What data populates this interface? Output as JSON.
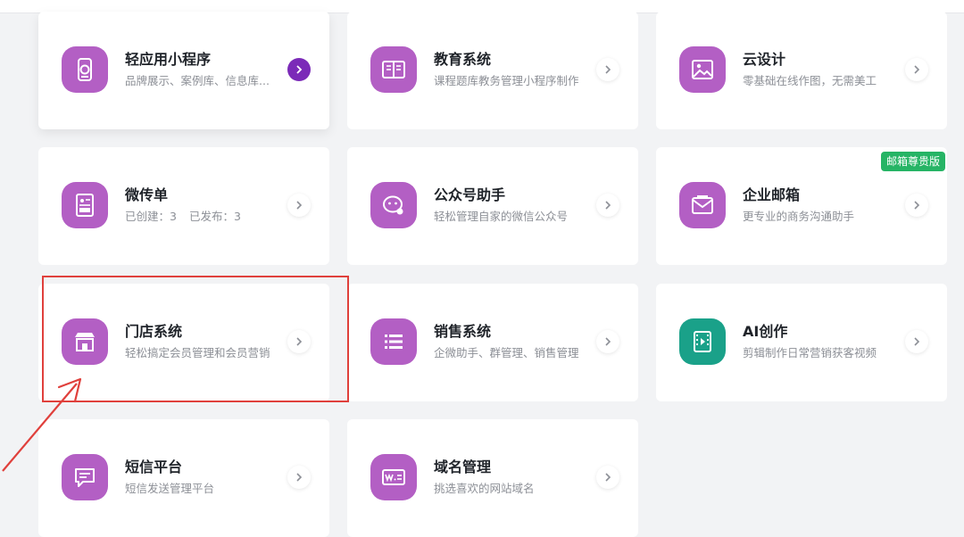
{
  "cards": [
    {
      "key": "mini-program",
      "title": "轻应用小程序",
      "subtitle": "品牌展示、案例库、信息库...",
      "icon": "mini-program-icon",
      "icon_color": "#b35fc4"
    },
    {
      "key": "education",
      "title": "教育系统",
      "subtitle": "课程题库教务管理小程序制作",
      "icon": "book-icon",
      "icon_color": "#b35fc4"
    },
    {
      "key": "cloud-design",
      "title": "云设计",
      "subtitle": "零基础在线作图，无需美工",
      "icon": "image-icon",
      "icon_color": "#b35fc4"
    },
    {
      "key": "flyer",
      "title": "微传单",
      "subtitle_created_label": "已创建：",
      "subtitle_created_value": "3",
      "subtitle_published_label": "已发布：",
      "subtitle_published_value": "3",
      "icon": "flyer-icon",
      "icon_color": "#b35fc4"
    },
    {
      "key": "official-account",
      "title": "公众号助手",
      "subtitle": "轻松管理自家的微信公众号",
      "icon": "wechat-icon",
      "icon_color": "#b35fc4"
    },
    {
      "key": "enterprise-mail",
      "title": "企业邮箱",
      "subtitle": "更专业的商务沟通助手",
      "icon": "mail-icon",
      "icon_color": "#b35fc4",
      "badge": "邮箱尊贵版",
      "badge_color": "#26b465"
    },
    {
      "key": "store-system",
      "title": "门店系统",
      "subtitle": "轻松搞定会员管理和会员营销",
      "icon": "store-icon",
      "icon_color": "#b35fc4"
    },
    {
      "key": "sales-system",
      "title": "销售系统",
      "subtitle": "企微助手、群管理、销售管理",
      "icon": "list-icon",
      "icon_color": "#b35fc4"
    },
    {
      "key": "ai-creation",
      "title": "AI创作",
      "subtitle": "剪辑制作日常营销获客视频",
      "icon": "video-icon",
      "icon_color": "#1aa189"
    },
    {
      "key": "sms-platform",
      "title": "短信平台",
      "subtitle": "短信发送管理平台",
      "icon": "message-icon",
      "icon_color": "#b35fc4"
    },
    {
      "key": "domain-management",
      "title": "域名管理",
      "subtitle": "挑选喜欢的网站域名",
      "icon": "domain-icon",
      "icon_color": "#b35fc4"
    }
  ],
  "annotation": {
    "highlight_color": "#e0403c"
  },
  "accent_color": "#7b2ab8"
}
